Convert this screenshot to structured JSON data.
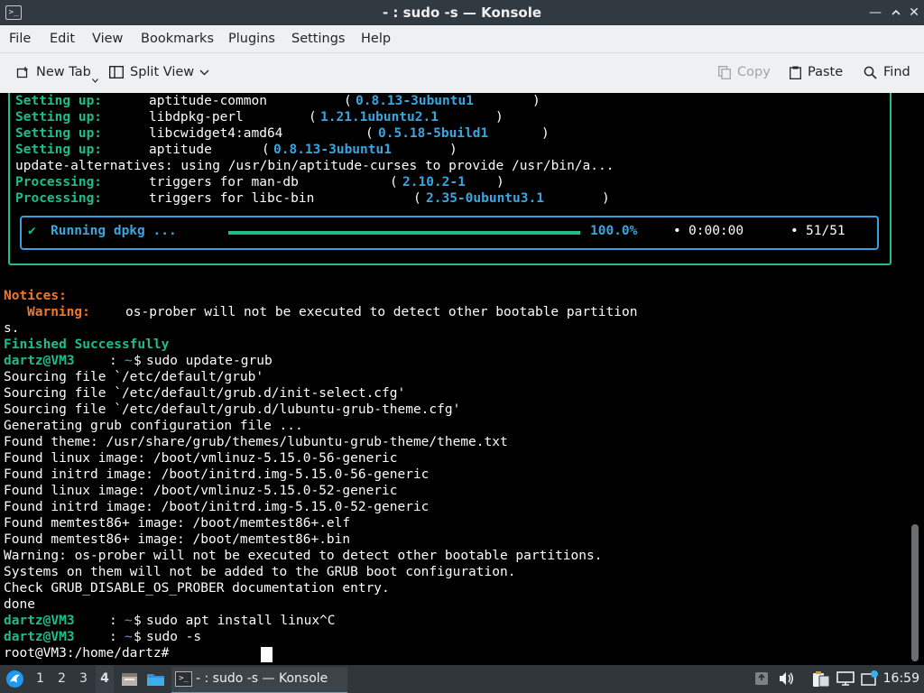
{
  "window": {
    "title": "- : sudo -s — Konsole"
  },
  "menubar": [
    "File",
    "Edit",
    "View",
    "Bookmarks",
    "Plugins",
    "Settings",
    "Help"
  ],
  "toolbar": {
    "new_tab": "New Tab",
    "split_view": "Split View",
    "copy": "Copy",
    "paste": "Paste",
    "find": "Find"
  },
  "terminal": {
    "setup_rows": [
      {
        "label": "Setting up:",
        "pkg": "aptitude-common",
        "ver": "0.8.13-3ubuntu1"
      },
      {
        "label": "Setting up:",
        "pkg": "libdpkg-perl",
        "ver": "1.21.1ubuntu2.1"
      },
      {
        "label": "Setting up:",
        "pkg": "libcwidget4:amd64",
        "ver": "0.5.18-5build1"
      },
      {
        "label": "Setting up:",
        "pkg": "aptitude",
        "ver": "0.8.13-3ubuntu1"
      }
    ],
    "update_alt": "update-alternatives: using /usr/bin/aptitude-curses to provide /usr/bin/a...",
    "processing_rows": [
      {
        "label": "Processing:",
        "pkg": "triggers for man-db",
        "ver": "2.10.2-1"
      },
      {
        "label": "Processing:",
        "pkg": "triggers for libc-bin",
        "ver": "2.35-0ubuntu3.1"
      }
    ],
    "progress": {
      "check": "✔",
      "label": "Running dpkg ...",
      "percent_text": "100.0%",
      "fraction": 1.0,
      "elapsed": "0:00:00",
      "count": "51/51",
      "bullet": "•"
    },
    "notices_label": "Notices:",
    "warning_label": "Warning:",
    "warning_text": "os-prober will not be executed to detect other bootable partition",
    "warning_wrap": "s.",
    "finished": "Finished Successfully",
    "prompt_user": "dartz@VM3",
    "prompt_sep": ":",
    "prompt_path": "~",
    "prompt_sign": "$",
    "cmd_update_grub": "sudo update-grub",
    "output": [
      "Sourcing file `/etc/default/grub'",
      "Sourcing file `/etc/default/grub.d/init-select.cfg'",
      "Sourcing file `/etc/default/grub.d/lubuntu-grub-theme.cfg'",
      "Generating grub configuration file ...",
      "Found theme: /usr/share/grub/themes/lubuntu-grub-theme/theme.txt",
      "Found linux image: /boot/vmlinuz-5.15.0-56-generic",
      "Found initrd image: /boot/initrd.img-5.15.0-56-generic",
      "Found linux image: /boot/vmlinuz-5.15.0-52-generic",
      "Found initrd image: /boot/initrd.img-5.15.0-52-generic",
      "Found memtest86+ image: /boot/memtest86+.elf",
      "Found memtest86+ image: /boot/memtest86+.bin",
      "Warning: os-prober will not be executed to detect other bootable partitions.",
      "Systems on them will not be added to the GRUB boot configuration.",
      "Check GRUB_DISABLE_OS_PROBER documentation entry.",
      "done"
    ],
    "cmd_apt": "sudo apt install linux^C",
    "cmd_sudo": "sudo -s",
    "root_prompt": "root@VM3:/home/dartz#"
  },
  "taskbar": {
    "desktops": [
      "1",
      "2",
      "3",
      "4"
    ],
    "active_desktop": "4",
    "task_label": "- : sudo -s — Konsole",
    "clock": "16:59"
  }
}
